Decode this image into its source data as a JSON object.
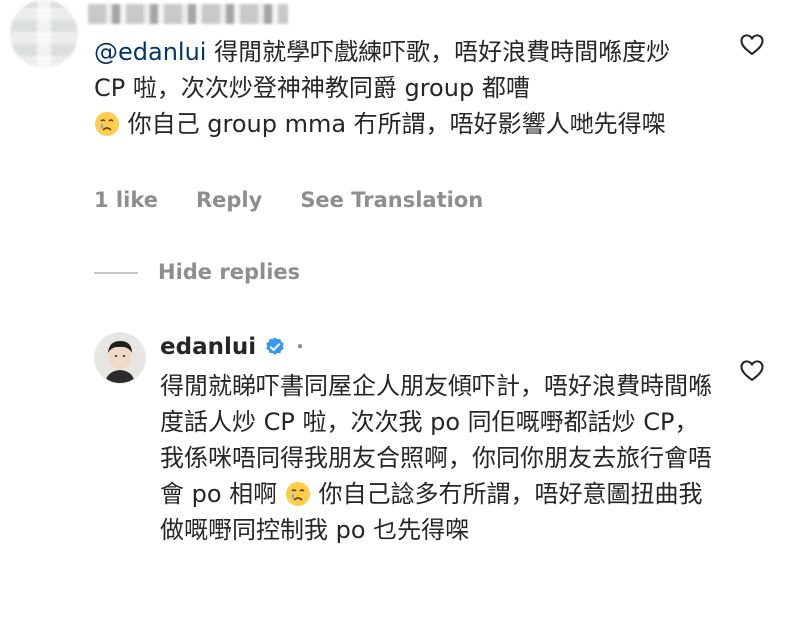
{
  "comment": {
    "mention": "@edanlui",
    "text_1": " 得閒就學吓戲練吓歌，唔好浪費時間喺度炒 CP 啦，次次炒登神神教同爵 group 都嘈",
    "emoji_1": "crying-face",
    "text_2": " 你自己 group mma 冇所謂，唔好影響人哋先得㗎",
    "likes": "1 like",
    "reply_label": "Reply",
    "translate_label": "See Translation"
  },
  "replies_toggle": {
    "label": "Hide replies"
  },
  "reply": {
    "username": "edanlui",
    "verified_icon": "verified-badge-icon",
    "text_1": "得閒就睇吓書同屋企人朋友傾吓計，唔好浪費時間喺度話人炒 CP 啦，次次我 po 同佢嘅嘢都話炒 CP，我係咪唔同得我朋友合照啊，你同你朋友去旅行會唔會 po 相啊",
    "emoji_1": "crying-face",
    "text_2": " 你自己諗多冇所謂，唔好意圖扭曲我做嘅嘢同控制我 po 乜先得㗎"
  },
  "colors": {
    "mention": "#00376b",
    "meta_gray": "#8e8e8e",
    "text": "#262626",
    "verified_blue": "#3797f0"
  }
}
